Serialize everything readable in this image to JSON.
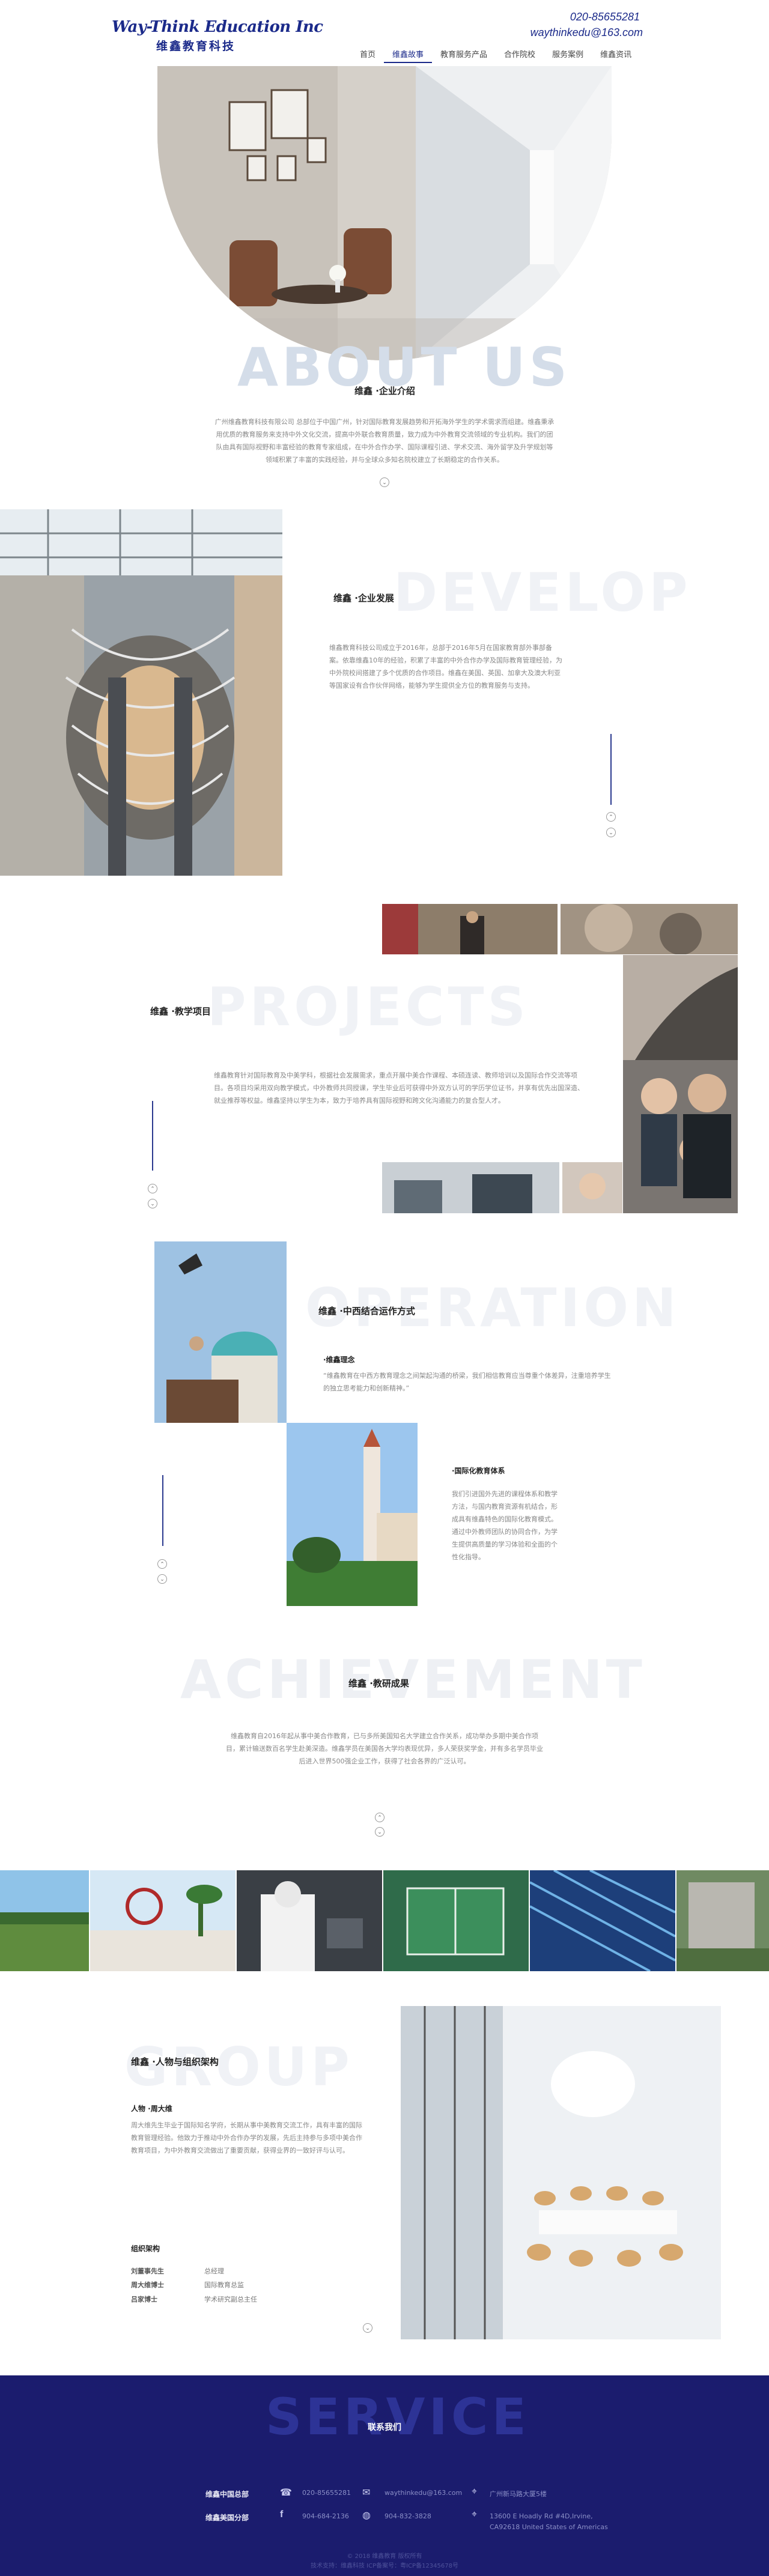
{
  "header": {
    "logo_en": "Way-Think Education Inc",
    "logo_cn": "维鑫教育科技",
    "phone": "020-85655281",
    "email": "waythinkedu@163.com",
    "nav": [
      "首页",
      "维鑫故事",
      "教育服务产品",
      "合作院校",
      "服务案例",
      "维鑫资讯"
    ]
  },
  "about": {
    "bg_word": "ABOUT US",
    "title": "维鑫 ·企业介绍",
    "text": "广州维鑫教育科技有限公司 总部位于中国广州，针对国际教育发展趋势和开拓海外学生的学术需求而组建。维鑫秉承用优质的教育服务来支持中外文化交流，提高中外联合教育质量，致力成为中外教育交流领域的专业机构。我们的团队由具有国际视野和丰富经验的教育专家组成，在中外合作办学、国际课程引进、学术交流、海外留学及升学规划等领域积累了丰富的实践经验，并与全球众多知名院校建立了长期稳定的合作关系。"
  },
  "develop": {
    "bg_word": "DEVELOP",
    "title": "维鑫 ·企业发展",
    "text": "维鑫教育科技公司成立于2016年，总部于2016年5月在国家教育部外事部备案。依靠维鑫10年的经验，积累了丰富的中外合作办学及国际教育管理经验，为中外院校间搭建了多个优质的合作项目。维鑫在美国、英国、加拿大及澳大利亚等国家设有合作伙伴网络，能够为学生提供全方位的教育服务与支持。"
  },
  "projects": {
    "bg_word": "PROJECTS",
    "title": "维鑫 ·教学项目",
    "text": "维鑫教育针对国际教育及中美学科，根据社会发展需求，重点开展中美合作课程、本硕连读、教师培训以及国际合作交流等项目。各项目均采用双向教学模式，中外教师共同授课，学生毕业后可获得中外双方认可的学历学位证书，并享有优先出国深造、就业推荐等权益。维鑫坚持以学生为本，致力于培养具有国际视野和跨文化沟通能力的复合型人才。"
  },
  "operation": {
    "bg_word": "OPERATION",
    "title": "维鑫 ·中西结合运作方式",
    "sub1": "·维鑫理念",
    "text1": "“维鑫教育在中西方教育理念之间架起沟通的桥梁，我们相信教育应当尊重个体差异，注重培养学生的独立思考能力和创新精神。”",
    "sub2": "·国际化教育体系",
    "text2": "我们引进国外先进的课程体系和教学方法，与国内教育资源有机结合，形成具有维鑫特色的国际化教育模式。通过中外教师团队的协同合作，为学生提供高质量的学习体验和全面的个性化指导。"
  },
  "achievement": {
    "bg_word": "ACHIEVEMENT",
    "title": "维鑫 ·教研成果",
    "text": "维鑫教育自2016年起从事中美合作教育，已与多所美国知名大学建立合作关系，成功举办多期中美合作项目，累计输送数百名学生赴美深造。维鑫学员在美国各大学均表现优异，多人荣获奖学金，并有多名学员毕业后进入世界500强企业工作，获得了社会各界的广泛认可。"
  },
  "group": {
    "bg_word": "GROUP",
    "title": "维鑫 ·人物与组织架构",
    "person_title": "人物 ·周大维",
    "person_text": "周大维先生毕业于国际知名学府，长期从事中美教育交流工作，具有丰富的国际教育管理经验。他致力于推动中外合作办学的发展，先后主持参与多项中美合作教育项目，为中外教育交流做出了重要贡献，获得业界的一致好评与认可。",
    "org_title": "组织架构",
    "rows": [
      {
        "label": "刘董事先生",
        "value": "总经理"
      },
      {
        "label": "周大维博士",
        "value": "国际教育总监"
      },
      {
        "label": "吕家博士",
        "value": "学术研究副总主任"
      }
    ]
  },
  "service": {
    "bg_word": "SERVICE",
    "title": "联系我们",
    "hq": "维鑫中国总部",
    "us": "维鑫美国分部",
    "hq_phone": "020-85655281",
    "hq_email": "waythinkedu@163.com",
    "hq_addr": "广州新马路大厦5楼",
    "us_phone1": "904-684-2136",
    "us_phone2": "904-832-3828",
    "us_addr1": "13600 E Hoadly Rd #4D,Irvine,",
    "us_addr2": "CA92618 United States of Americas",
    "copyright": "© 2018 维鑫教育 版权所有",
    "footer2": "技术支持：维鑫科技 ICP备案号：粤ICP备12345678号"
  },
  "colors": {
    "brand": "#1b2a8a",
    "service_bg": "#1b1c6e"
  }
}
